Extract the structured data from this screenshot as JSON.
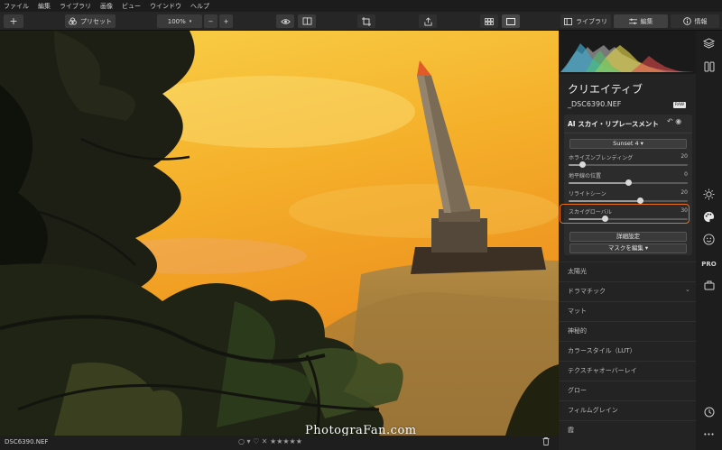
{
  "menu": [
    "ファイル",
    "編集",
    "ライブラリ",
    "画像",
    "ビュー",
    "ウインドウ",
    "ヘルプ"
  ],
  "toolbar": {
    "add_label": "+",
    "preset_label": "プリセット",
    "zoom_value": "100%",
    "zoom_out": "−",
    "zoom_in": "+",
    "library_tab": "ライブラリ",
    "edit_tab": "編集",
    "info_tab": "情報"
  },
  "photo": {
    "watermark": "PhotograFan.com"
  },
  "statusbar": {
    "filename": "DSC6390.NEF",
    "center_controls": "○ ▾   ♡   ✕ ★★★★★",
    "trash_icon": "trash-icon"
  },
  "panel": {
    "title": "クリエイティブ",
    "filename": "_DSC6390.NEF",
    "raw_badge": "RAW",
    "module": {
      "title": "AI スカイ・リプレースメント",
      "icons": "↶ ◉",
      "dropdown_value": "Sunset 4 ▾",
      "sliders": [
        {
          "label": "ホライズンブレンディング",
          "value": "20",
          "level": 0.11
        },
        {
          "label": "地平線の位置",
          "value": "0",
          "level": 0.5
        },
        {
          "label": "リライトシーン",
          "value": "20",
          "level": 0.6
        },
        {
          "label": "スカイグローバル",
          "value": "30",
          "level": 0.3
        }
      ],
      "advanced_button": "詳細設定",
      "mask_button": "マスクを編集 ▾"
    },
    "tools": [
      {
        "label": "太陽光"
      },
      {
        "label": "ドラマチック",
        "chevron": "⌄"
      },
      {
        "label": "マット"
      },
      {
        "label": "神秘的"
      },
      {
        "label": "カラースタイル（LUT）"
      },
      {
        "label": "テクスチャオーバーレイ"
      },
      {
        "label": "グロー"
      },
      {
        "label": "フィルムグレイン"
      },
      {
        "label": "霞"
      }
    ]
  },
  "strip": {
    "pro_label": "PRO",
    "more_label": "•••"
  },
  "colors": {
    "highlight": "#e86d1e",
    "panel_bg": "#232323",
    "toolbar_bg": "#262626"
  }
}
